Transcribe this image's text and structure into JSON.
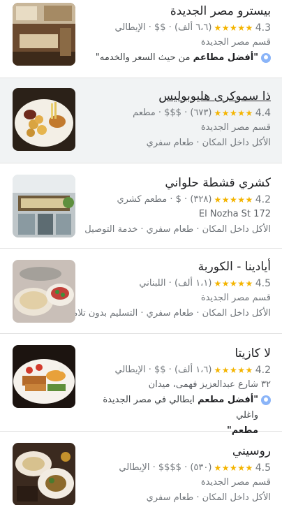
{
  "results": [
    {
      "name": "بيسترو مصر الجديدة",
      "rating": "4.3",
      "stars": "★★★★★",
      "meta": "(٦،٦ ألف) · $$ · الإيطالي",
      "area": "قسم مصر الجديدة",
      "review_bold": "\"أفضل مطاعم",
      "review_rest": " من حيث السعر والخدمه\""
    },
    {
      "name": "ذا سموكرى هليوبوليس",
      "rating": "4.4",
      "stars": "★★★★★",
      "meta": "(٦٧٣) · $$$ · مطعم",
      "area": "قسم مصر الجديدة",
      "services": "الأكل داخل المكان · طعام سفري"
    },
    {
      "name": "كشري قشطة حلواني",
      "rating": "4.2",
      "stars": "★★★★★",
      "meta": "(٣٢٨) · $ · مطعم كشري",
      "area": "172 El Nozha St",
      "services": "الأكل داخل المكان · طعام سفري · خدمة التوصيل"
    },
    {
      "name": "أيادينا - الكوربة",
      "rating": "4.5",
      "stars": "★★★★★",
      "meta": "(١،١ ألف) · اللبناني",
      "area": "قسم مصر الجديدة",
      "services": "الأكل داخل المكان · طعام سفري · التسليم بدون تلامس"
    },
    {
      "name": "لا كازيتا",
      "rating": "4.2",
      "stars": "★★★★★",
      "meta": "(١،٦ ألف) · $$ · الإيطالي",
      "area": "٣٢ شارع عبدالعزيز فهمى، ميدان",
      "review_bold": "\"أفضل مطعم",
      "review_rest": " ايطالي في مصر الجديدة واغلي",
      "review_line2": "مطعم\""
    },
    {
      "name": "روسيني",
      "rating": "4.5",
      "stars": "★★★★★",
      "meta": "(٥٣٠) · $$$$ · الإيطالي",
      "area": "قسم مصر الجديدة",
      "services": "الأكل داخل المكان · طعام سفري"
    }
  ]
}
